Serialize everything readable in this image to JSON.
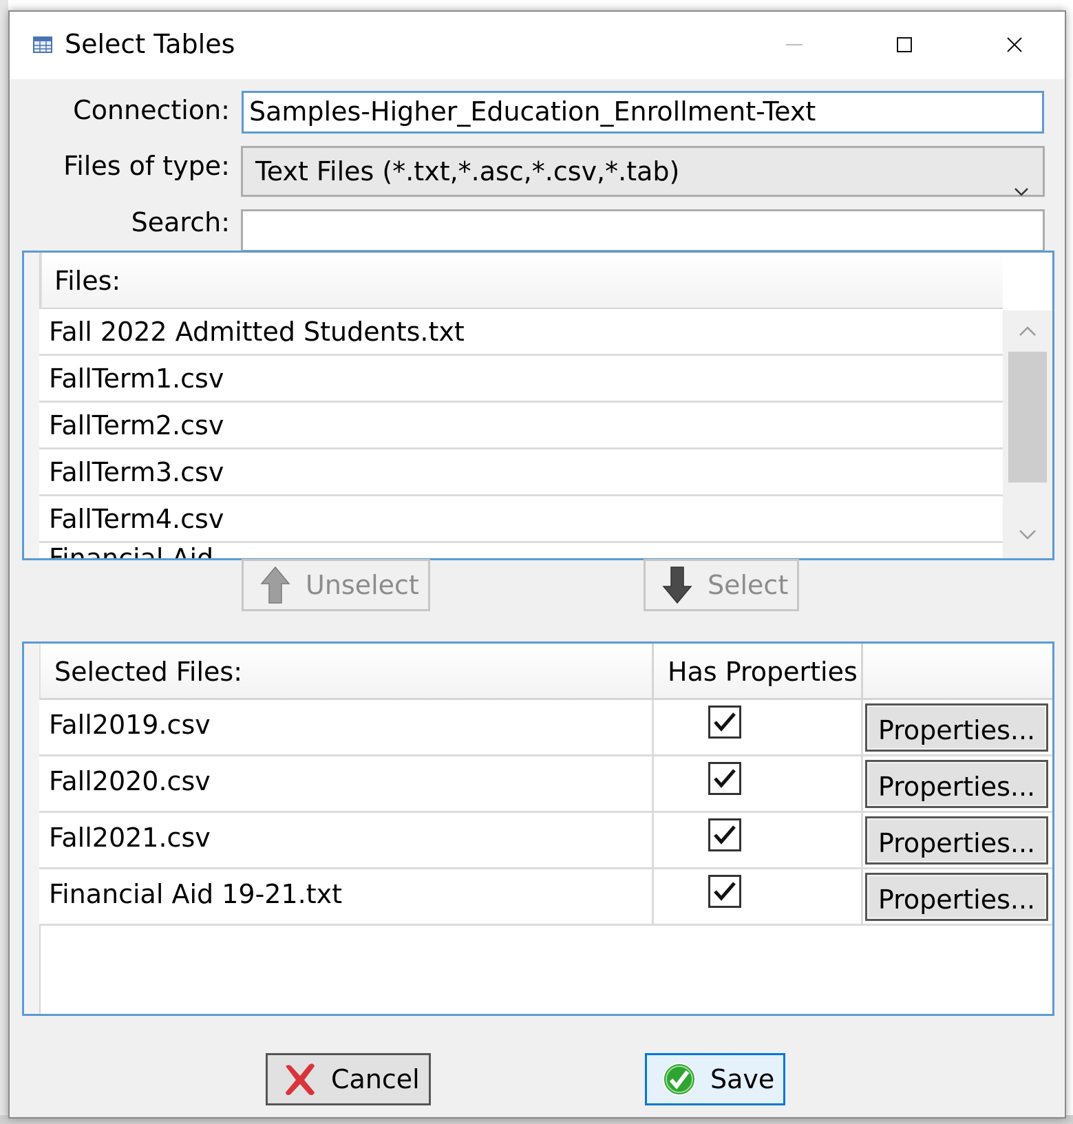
{
  "window": {
    "title": "Select Tables",
    "icons": {
      "app": "table-icon",
      "minimize": "minimize-icon",
      "maximize": "maximize-icon",
      "close": "close-icon"
    }
  },
  "form": {
    "connection_label": "Connection:",
    "connection_value": "Samples-Higher_Education_Enrollment-Text",
    "type_label": "Files of type:",
    "type_value": "Text Files (*.txt,*.asc,*.csv,*.tab)",
    "search_label": "Search:",
    "search_value": ""
  },
  "files": {
    "header": "Files:",
    "items": [
      "Fall 2022 Admitted Students.txt",
      "FallTerm1.csv",
      "FallTerm2.csv",
      "FallTerm3.csv",
      "FallTerm4.csv",
      "Financial Aid"
    ]
  },
  "actions": {
    "unselect_label": "Unselect",
    "select_label": "Select"
  },
  "selected": {
    "header_name": "Selected Files:",
    "header_props": "Has Properties",
    "rows": [
      {
        "name": "Fall2019.csv",
        "has_properties": true,
        "button": "Properties..."
      },
      {
        "name": "Fall2020.csv",
        "has_properties": true,
        "button": "Properties..."
      },
      {
        "name": "Fall2021.csv",
        "has_properties": true,
        "button": "Properties..."
      },
      {
        "name": "Financial Aid 19-21.txt",
        "has_properties": true,
        "button": "Properties..."
      }
    ]
  },
  "footer": {
    "cancel_label": "Cancel",
    "save_label": "Save"
  },
  "colors": {
    "accent": "#5b9bd5",
    "cancel_x": "#d9343b",
    "save_check": "#2fa52f"
  }
}
